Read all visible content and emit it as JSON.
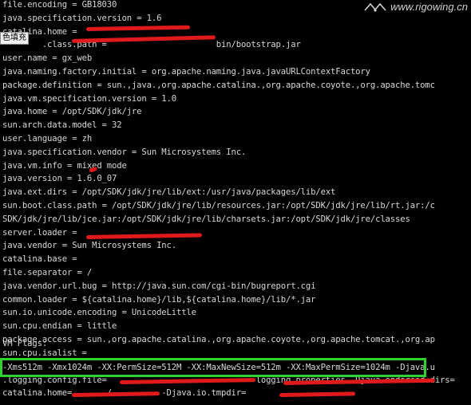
{
  "watermark": {
    "text": "www.rigowing.cn"
  },
  "tooltip": {
    "text": "色填充"
  },
  "lines": [
    "file.encoding = GB18030",
    "java.specification.version = 1.6",
    "catalina.home =",
    "        .class.path =                      bin/bootstrap.jar",
    "user.name = gx_web",
    "java.naming.factory.initial = org.apache.naming.java.javaURLContextFactory",
    "package.definition = sun.,java.,org.apache.catalina.,org.apache.coyote.,org.apache.tomc",
    "java.vm.specification.version = 1.0",
    "java.home = /opt/SDK/jdk/jre",
    "sun.arch.data.model = 32",
    "user.language = zh",
    "java.specification.vendor = Sun Microsystems Inc.",
    "java.vm.info = mixed mode",
    "java.version = 1.6.0_07",
    "java.ext.dirs = /opt/SDK/jdk/jre/lib/ext:/usr/java/packages/lib/ext",
    "sun.boot.class.path = /opt/SDK/jdk/jre/lib/resources.jar:/opt/SDK/jdk/jre/lib/rt.jar:/c",
    "SDK/jdk/jre/lib/jce.jar:/opt/SDK/jdk/jre/lib/charsets.jar:/opt/SDK/jdk/jre/classes",
    "server.loader =",
    "java.vendor = Sun Microsystems Inc.",
    "catalina.base =",
    "file.separator = /",
    "java.vendor.url.bug = http://java.sun.com/cgi-bin/bugreport.cgi",
    "common.loader = ${catalina.home}/lib,${catalina.home}/lib/*.jar",
    "sun.io.unicode.encoding = UnicodeLittle",
    "sun.cpu.endian = little",
    "package.access = sun.,org.apache.catalina.,org.apache.coyote.,org.apache.tomcat.,org.ap",
    "sun.cpu.isalist ="
  ],
  "vm_flags_heading": "VM Flags:",
  "vm_flags_lines": [
    "-Xms512m -Xmx1024m -XX:PermSize=512M -XX:MaxNewSize=512m -XX:MaxPermSize=1024m -Djava.u",
    ".logging.config.file=                              logging.properties -Djava.endorsed.dirs=",
    "catalina.home=       /          -Djava.io.tmpdir="
  ]
}
